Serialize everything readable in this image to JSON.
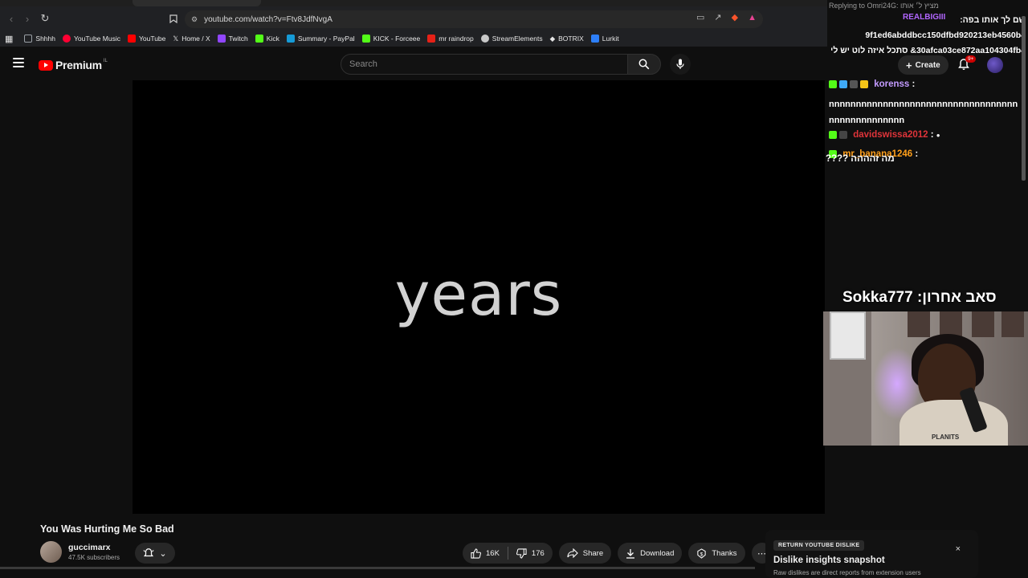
{
  "browser": {
    "url": "youtube.com/watch?v=Ftv8JdfNvgA",
    "bookmarks": [
      {
        "label": "Shhhh",
        "color": "#9aa0a6"
      },
      {
        "label": "YouTube Music",
        "color": "#ff0033"
      },
      {
        "label": "YouTube",
        "color": "#ff0000"
      },
      {
        "label": "Home / X",
        "color": "#ffffff"
      },
      {
        "label": "Twitch",
        "color": "#9146ff"
      },
      {
        "label": "Kick",
        "color": "#53fc18"
      },
      {
        "label": "Summary - PayPal",
        "color": "#169bd7"
      },
      {
        "label": "KICK - Forceee",
        "color": "#53fc18"
      },
      {
        "label": "mr raindrop",
        "color": "#e62117"
      },
      {
        "label": "StreamElements",
        "color": "#c9c9c9"
      },
      {
        "label": "BOTRIX",
        "color": "#ffffff"
      },
      {
        "label": "Lurkit",
        "color": "#2d7ff9"
      }
    ]
  },
  "youtube": {
    "brand": "Premium",
    "country": "IL",
    "search_placeholder": "Search",
    "create_label": "Create",
    "notification_count": "9+"
  },
  "video": {
    "frame_text": "years",
    "title": "You Was Hurting Me So Bad",
    "channel_name": "guccimarx",
    "subscribers": "47.5K subscribers",
    "likes": "16K",
    "dislikes": "176",
    "share_label": "Share",
    "download_label": "Download",
    "thanks_label": "Thanks"
  },
  "dislike_card": {
    "badge": "RETURN YOUTUBE DISLIKE",
    "title": "Dislike insights snapshot",
    "description": "Raw dislikes are direct reports from extension users",
    "close": "×"
  },
  "chat": {
    "reply_header": "Replying to Omri24G: מציץ ל׳ אותו",
    "messages": [
      {
        "user": "REALBIGIII",
        "user_color": "#b266ff",
        "text": "שם לך אותו בפה: 9f1ed6abddbcc150dfbd920213eb4560b4 30afca03ce872aa104304fb4& סתכל איזה לוט יש לי"
      },
      {
        "user": "korenss",
        "user_color": "#c39bff",
        "text": "nnnnnnnnnnnnnnnnnnnnnnnnnnnnnnnnnnnnnnnnnnnnnnnnn"
      },
      {
        "user": "davidswissa2012",
        "user_color": "#e0343a",
        "text": ""
      },
      {
        "user": "mr_banana1246",
        "user_color": "#ff9f1a",
        "text": "מה זהההה ????"
      }
    ],
    "sub_alert": "סאב אחרון: Sokka777",
    "webcam_shirt_text": "PLANITS"
  }
}
